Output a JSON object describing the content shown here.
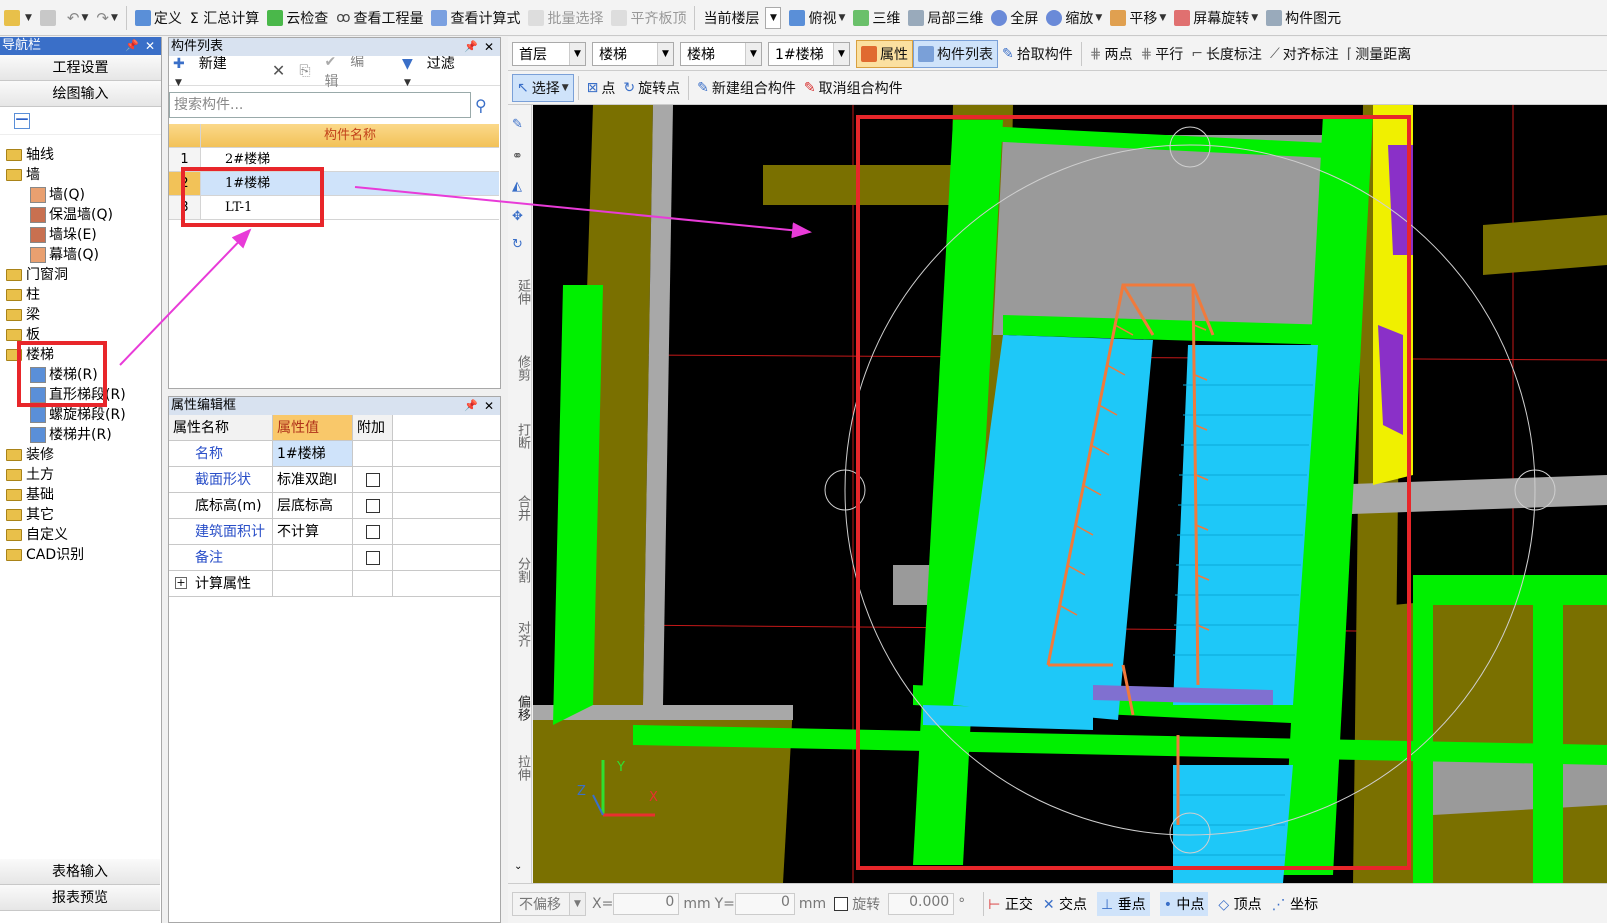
{
  "toolbar": {
    "items": [
      "定义",
      "Σ 汇总计算",
      "云检查",
      "查看工程量",
      "查看计算式",
      "批量选择",
      "平齐板顶",
      "当前楼层",
      "俯视",
      "三维",
      "局部三维",
      "全屏",
      "缩放",
      "平移",
      "屏幕旋转",
      "构件图元"
    ]
  },
  "nav": {
    "title": "导航栏",
    "project_settings": "工程设置",
    "drawing_input": "绘图输入",
    "tree": [
      {
        "label": "轴线",
        "level": 0
      },
      {
        "label": "墙",
        "level": 0
      },
      {
        "label": "墙(Q)",
        "level": 1
      },
      {
        "label": "保温墙(Q)",
        "level": 1
      },
      {
        "label": "墙垛(E)",
        "level": 1
      },
      {
        "label": "幕墙(Q)",
        "level": 1
      },
      {
        "label": "门窗洞",
        "level": 0
      },
      {
        "label": "柱",
        "level": 0
      },
      {
        "label": "梁",
        "level": 0
      },
      {
        "label": "板",
        "level": 0
      },
      {
        "label": "楼梯",
        "level": 0
      },
      {
        "label": "楼梯(R)",
        "level": 1
      },
      {
        "label": "直形梯段(R)",
        "level": 1
      },
      {
        "label": "螺旋梯段(R)",
        "level": 1
      },
      {
        "label": "楼梯井(R)",
        "level": 1
      },
      {
        "label": "装修",
        "level": 0
      },
      {
        "label": "土方",
        "level": 0
      },
      {
        "label": "基础",
        "level": 0
      },
      {
        "label": "其它",
        "level": 0
      },
      {
        "label": "自定义",
        "level": 0
      },
      {
        "label": "CAD识别",
        "level": 0
      }
    ],
    "table_input": "表格输入",
    "report_preview": "报表预览"
  },
  "complist": {
    "title": "构件列表",
    "new": "新建",
    "edit": "编辑",
    "filter": "过滤",
    "search_placeholder": "搜索构件...",
    "header": "构件名称",
    "rows": [
      {
        "n": "1",
        "name": "2#楼梯"
      },
      {
        "n": "2",
        "name": "1#楼梯"
      },
      {
        "n": "3",
        "name": "LT-1"
      }
    ]
  },
  "props": {
    "title": "属性编辑框",
    "col_name": "属性名称",
    "col_value": "属性值",
    "col_extra": "附加",
    "rows": [
      {
        "name": "名称",
        "value": "1#楼梯",
        "check": false
      },
      {
        "name": "截面形状",
        "value": "标准双跑I",
        "check": true
      },
      {
        "name": "底标高(m)",
        "value": "层底标高",
        "check": true
      },
      {
        "name": "建筑面积计",
        "value": "不计算",
        "check": true
      },
      {
        "name": "备注",
        "value": "",
        "check": true
      },
      {
        "name": "计算属性",
        "value": "",
        "check": false
      }
    ]
  },
  "drawbar": {
    "floor": "首层",
    "type1": "楼梯",
    "type2": "楼梯",
    "component": "1#楼梯",
    "property": "属性",
    "component_list": "构件列表",
    "pick": "拾取构件",
    "two_points": "两点",
    "parallel": "平行",
    "length_dim": "长度标注",
    "align_dim": "对齐标注",
    "measure": "测量距离",
    "select": "选择",
    "point": "点",
    "rotate_point": "旋转点",
    "new_group": "新建组合构件",
    "cancel_group": "取消组合构件"
  },
  "vtools": [
    "延伸",
    "修剪",
    "打断",
    "合并",
    "分割",
    "对齐",
    "偏移",
    "拉伸"
  ],
  "statusbar": {
    "no_offset": "不偏移",
    "x_label": "X=",
    "x_value": "0",
    "y_label": "Y=",
    "y_value": "0",
    "unit": "mm",
    "rotate": "旋转",
    "angle": "0.000",
    "ortho": "正交",
    "intersect": "交点",
    "perpendicular": "垂点",
    "midpoint": "中点",
    "vertex": "顶点",
    "coord": "坐标"
  },
  "colors": {
    "accent": "#3a6fc8",
    "highlight": "#e8262a",
    "arrow": "#e83bd8",
    "stair": "#1ec8f8",
    "beam": "#00f000",
    "rail": "#f07a3c"
  }
}
